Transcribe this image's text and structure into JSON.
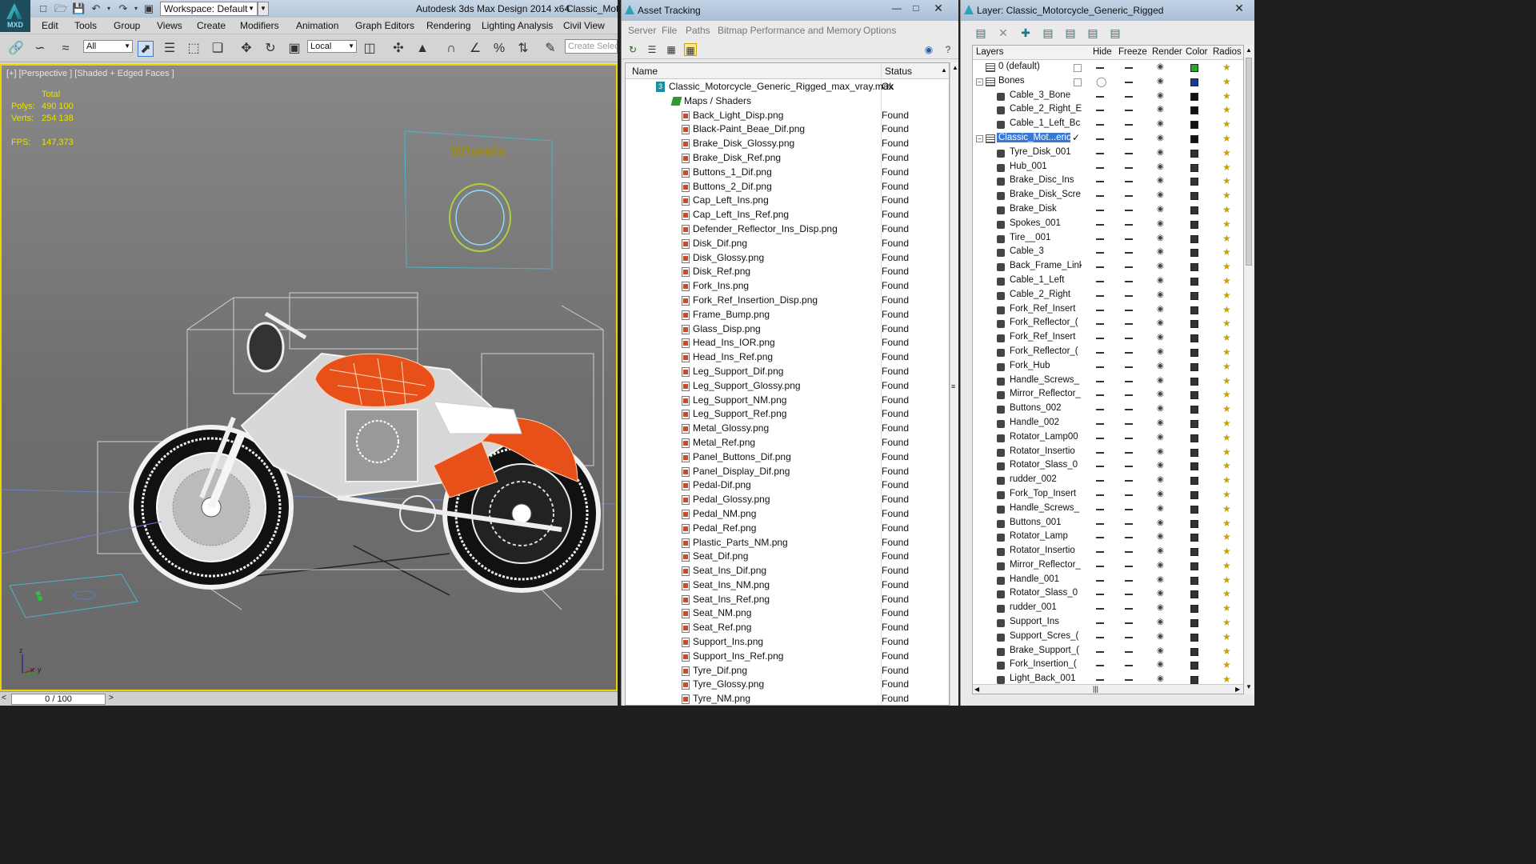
{
  "max_window": {
    "app_label": "MXD",
    "workspace_prefix": "Workspace: ",
    "workspace": "Default",
    "title": "Autodesk 3ds Max Design 2014 x64",
    "title_file": "Classic_Moto",
    "menus": [
      "Edit",
      "Tools",
      "Group",
      "Views",
      "Create",
      "Modifiers",
      "Animation",
      "Graph Editors",
      "Rendering",
      "Lighting Analysis",
      "Civil View"
    ],
    "selection_filter": "All",
    "ref_coord": "Local",
    "create_selection_placeholder": "Create Selec",
    "viewport": {
      "label": "[+] [Perspective ] [Shaded + Edged Faces ]",
      "stats_header": "Total",
      "polys_label": "Polys:",
      "polys_value": "490 100",
      "verts_label": "Verts:",
      "verts_value": "254 138",
      "fps_label": "FPS:",
      "fps_value": "147,373",
      "helper_label": "Wheels"
    },
    "time_slider": "0 / 100"
  },
  "asset_tracking": {
    "title": "Asset Tracking",
    "menus": [
      "Server",
      "File",
      "Paths",
      "Bitmap Performance and Memory",
      "Options"
    ],
    "columns": {
      "name": "Name",
      "status": "Status"
    },
    "root": {
      "name": "Classic_Motorcycle_Generic_Rigged_max_vray.max",
      "status": "Ok",
      "icon_label": "3"
    },
    "folder": "Maps / Shaders",
    "files": [
      {
        "name": "Back_Light_Disp.png",
        "status": "Found"
      },
      {
        "name": "Black-Paint_Beae_Dif.png",
        "status": "Found"
      },
      {
        "name": "Brake_Disk_Glossy.png",
        "status": "Found"
      },
      {
        "name": "Brake_Disk_Ref.png",
        "status": "Found"
      },
      {
        "name": "Buttons_1_Dif.png",
        "status": "Found"
      },
      {
        "name": "Buttons_2_Dif.png",
        "status": "Found"
      },
      {
        "name": "Cap_Left_Ins.png",
        "status": "Found"
      },
      {
        "name": "Cap_Left_Ins_Ref.png",
        "status": "Found"
      },
      {
        "name": "Defender_Reflector_Ins_Disp.png",
        "status": "Found"
      },
      {
        "name": "Disk_Dif.png",
        "status": "Found"
      },
      {
        "name": "Disk_Glossy.png",
        "status": "Found"
      },
      {
        "name": "Disk_Ref.png",
        "status": "Found"
      },
      {
        "name": "Fork_Ins.png",
        "status": "Found"
      },
      {
        "name": "Fork_Ref_Insertion_Disp.png",
        "status": "Found"
      },
      {
        "name": "Frame_Bump.png",
        "status": "Found"
      },
      {
        "name": "Glass_Disp.png",
        "status": "Found"
      },
      {
        "name": "Head_Ins_IOR.png",
        "status": "Found"
      },
      {
        "name": "Head_Ins_Ref.png",
        "status": "Found"
      },
      {
        "name": "Leg_Support_Dif.png",
        "status": "Found"
      },
      {
        "name": "Leg_Support_Glossy.png",
        "status": "Found"
      },
      {
        "name": "Leg_Support_NM.png",
        "status": "Found"
      },
      {
        "name": "Leg_Support_Ref.png",
        "status": "Found"
      },
      {
        "name": "Metal_Glossy.png",
        "status": "Found"
      },
      {
        "name": "Metal_Ref.png",
        "status": "Found"
      },
      {
        "name": "Panel_Buttons_Dif.png",
        "status": "Found"
      },
      {
        "name": "Panel_Display_Dif.png",
        "status": "Found"
      },
      {
        "name": "Pedal-Dif.png",
        "status": "Found"
      },
      {
        "name": "Pedal_Glossy.png",
        "status": "Found"
      },
      {
        "name": "Pedal_NM.png",
        "status": "Found"
      },
      {
        "name": "Pedal_Ref.png",
        "status": "Found"
      },
      {
        "name": "Plastic_Parts_NM.png",
        "status": "Found"
      },
      {
        "name": "Seat_Dif.png",
        "status": "Found"
      },
      {
        "name": "Seat_Ins_Dif.png",
        "status": "Found"
      },
      {
        "name": "Seat_Ins_NM.png",
        "status": "Found"
      },
      {
        "name": "Seat_Ins_Ref.png",
        "status": "Found"
      },
      {
        "name": "Seat_NM.png",
        "status": "Found"
      },
      {
        "name": "Seat_Ref.png",
        "status": "Found"
      },
      {
        "name": "Support_Ins.png",
        "status": "Found"
      },
      {
        "name": "Support_Ins_Ref.png",
        "status": "Found"
      },
      {
        "name": "Tyre_Dif.png",
        "status": "Found"
      },
      {
        "name": "Tyre_Glossy.png",
        "status": "Found"
      },
      {
        "name": "Tyre_NM.png",
        "status": "Found"
      }
    ]
  },
  "layer_window": {
    "title": "Layer: Classic_Motorcycle_Generic_Rigged",
    "columns": {
      "layers": "Layers",
      "hide": "Hide",
      "freeze": "Freeze",
      "render": "Render",
      "color": "Color",
      "radios": "Radios"
    },
    "layers": [
      {
        "name": "0 (default)",
        "kind": "layer",
        "color": "#22aa22"
      },
      {
        "name": "Bones",
        "kind": "layer",
        "color": "#1a3a9a"
      },
      {
        "name": "Cable_3_Bone",
        "kind": "object",
        "color": "#111111"
      },
      {
        "name": "Cable_2_Right_E",
        "kind": "object",
        "color": "#111111"
      },
      {
        "name": "Cable_1_Left_Bc",
        "kind": "object",
        "color": "#111111"
      },
      {
        "name": "Classic_Mot...eric_F",
        "kind": "layer",
        "color": "#111111",
        "selected": true
      },
      {
        "name": "Tyre_Disk_001",
        "kind": "object",
        "color": "#333333"
      },
      {
        "name": "Hub_001",
        "kind": "object",
        "color": "#333333"
      },
      {
        "name": "Brake_Disc_Ins",
        "kind": "object",
        "color": "#333333"
      },
      {
        "name": "Brake_Disk_Scre",
        "kind": "object",
        "color": "#333333"
      },
      {
        "name": "Brake_Disk",
        "kind": "object",
        "color": "#333333"
      },
      {
        "name": "Spokes_001",
        "kind": "object",
        "color": "#333333"
      },
      {
        "name": "Tire__001",
        "kind": "object",
        "color": "#333333"
      },
      {
        "name": "Cable_3",
        "kind": "object",
        "color": "#333333"
      },
      {
        "name": "Back_Frame_Link",
        "kind": "object",
        "color": "#333333"
      },
      {
        "name": "Cable_1_Left",
        "kind": "object",
        "color": "#333333"
      },
      {
        "name": "Cable_2_Right",
        "kind": "object",
        "color": "#333333"
      },
      {
        "name": "Fork_Ref_Insert",
        "kind": "object",
        "color": "#333333"
      },
      {
        "name": "Fork_Reflector_(",
        "kind": "object",
        "color": "#333333"
      },
      {
        "name": "Fork_Ref_Insert",
        "kind": "object",
        "color": "#333333"
      },
      {
        "name": "Fork_Reflector_(",
        "kind": "object",
        "color": "#333333"
      },
      {
        "name": "Fork_Hub",
        "kind": "object",
        "color": "#333333"
      },
      {
        "name": "Handle_Screws_",
        "kind": "object",
        "color": "#333333"
      },
      {
        "name": "Mirror_Reflector_",
        "kind": "object",
        "color": "#333333"
      },
      {
        "name": "Buttons_002",
        "kind": "object",
        "color": "#333333"
      },
      {
        "name": "Handle_002",
        "kind": "object",
        "color": "#333333"
      },
      {
        "name": "Rotator_Lamp00",
        "kind": "object",
        "color": "#333333"
      },
      {
        "name": "Rotator_Insertio",
        "kind": "object",
        "color": "#333333"
      },
      {
        "name": "Rotator_Slass_0",
        "kind": "object",
        "color": "#333333"
      },
      {
        "name": "rudder_002",
        "kind": "object",
        "color": "#333333"
      },
      {
        "name": "Fork_Top_Insert",
        "kind": "object",
        "color": "#333333"
      },
      {
        "name": "Handle_Screws_",
        "kind": "object",
        "color": "#333333"
      },
      {
        "name": "Buttons_001",
        "kind": "object",
        "color": "#333333"
      },
      {
        "name": "Rotator_Lamp",
        "kind": "object",
        "color": "#333333"
      },
      {
        "name": "Rotator_Insertio",
        "kind": "object",
        "color": "#333333"
      },
      {
        "name": "Mirror_Reflector_",
        "kind": "object",
        "color": "#333333"
      },
      {
        "name": "Handle_001",
        "kind": "object",
        "color": "#333333"
      },
      {
        "name": "Rotator_Slass_0",
        "kind": "object",
        "color": "#333333"
      },
      {
        "name": "rudder_001",
        "kind": "object",
        "color": "#333333"
      },
      {
        "name": "Support_Ins",
        "kind": "object",
        "color": "#333333"
      },
      {
        "name": "Support_Scres_(",
        "kind": "object",
        "color": "#333333"
      },
      {
        "name": "Brake_Support_(",
        "kind": "object",
        "color": "#333333"
      },
      {
        "name": "Fork_Insertion_(",
        "kind": "object",
        "color": "#333333"
      },
      {
        "name": "Light_Back_001",
        "kind": "object",
        "color": "#333333"
      }
    ]
  },
  "colors": {
    "accent_selection": "#3a78d8",
    "viewport_border": "#e8d400",
    "wire_orange": "#e8501a"
  }
}
